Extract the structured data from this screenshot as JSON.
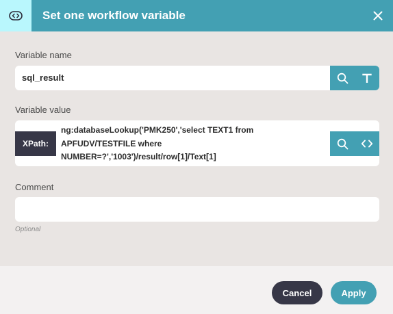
{
  "dialog": {
    "title": "Set one workflow variable",
    "icon": "variable-icon",
    "close_icon": "close-icon"
  },
  "variable_name": {
    "label": "Variable name",
    "value": "sql_result",
    "search_icon": "search-icon",
    "type_icon": "text-type-icon"
  },
  "variable_value": {
    "label": "Variable value",
    "type_badge": "XPath:",
    "value": "ng:databaseLookup('PMK250','select TEXT1 from APFUDV/TESTFILE where NUMBER=?','1003')/result/row[1]/Text[1]",
    "search_icon": "search-icon",
    "code_icon": "code-icon"
  },
  "comment": {
    "label": "Comment",
    "value": "",
    "hint": "Optional"
  },
  "footer": {
    "cancel_label": "Cancel",
    "apply_label": "Apply"
  },
  "colors": {
    "header": "#43a0b3",
    "header_icon_bg": "#b9f7fd",
    "body_bg": "#e9e5e3",
    "dark_button": "#373747",
    "accent_button": "#43a0b3"
  }
}
